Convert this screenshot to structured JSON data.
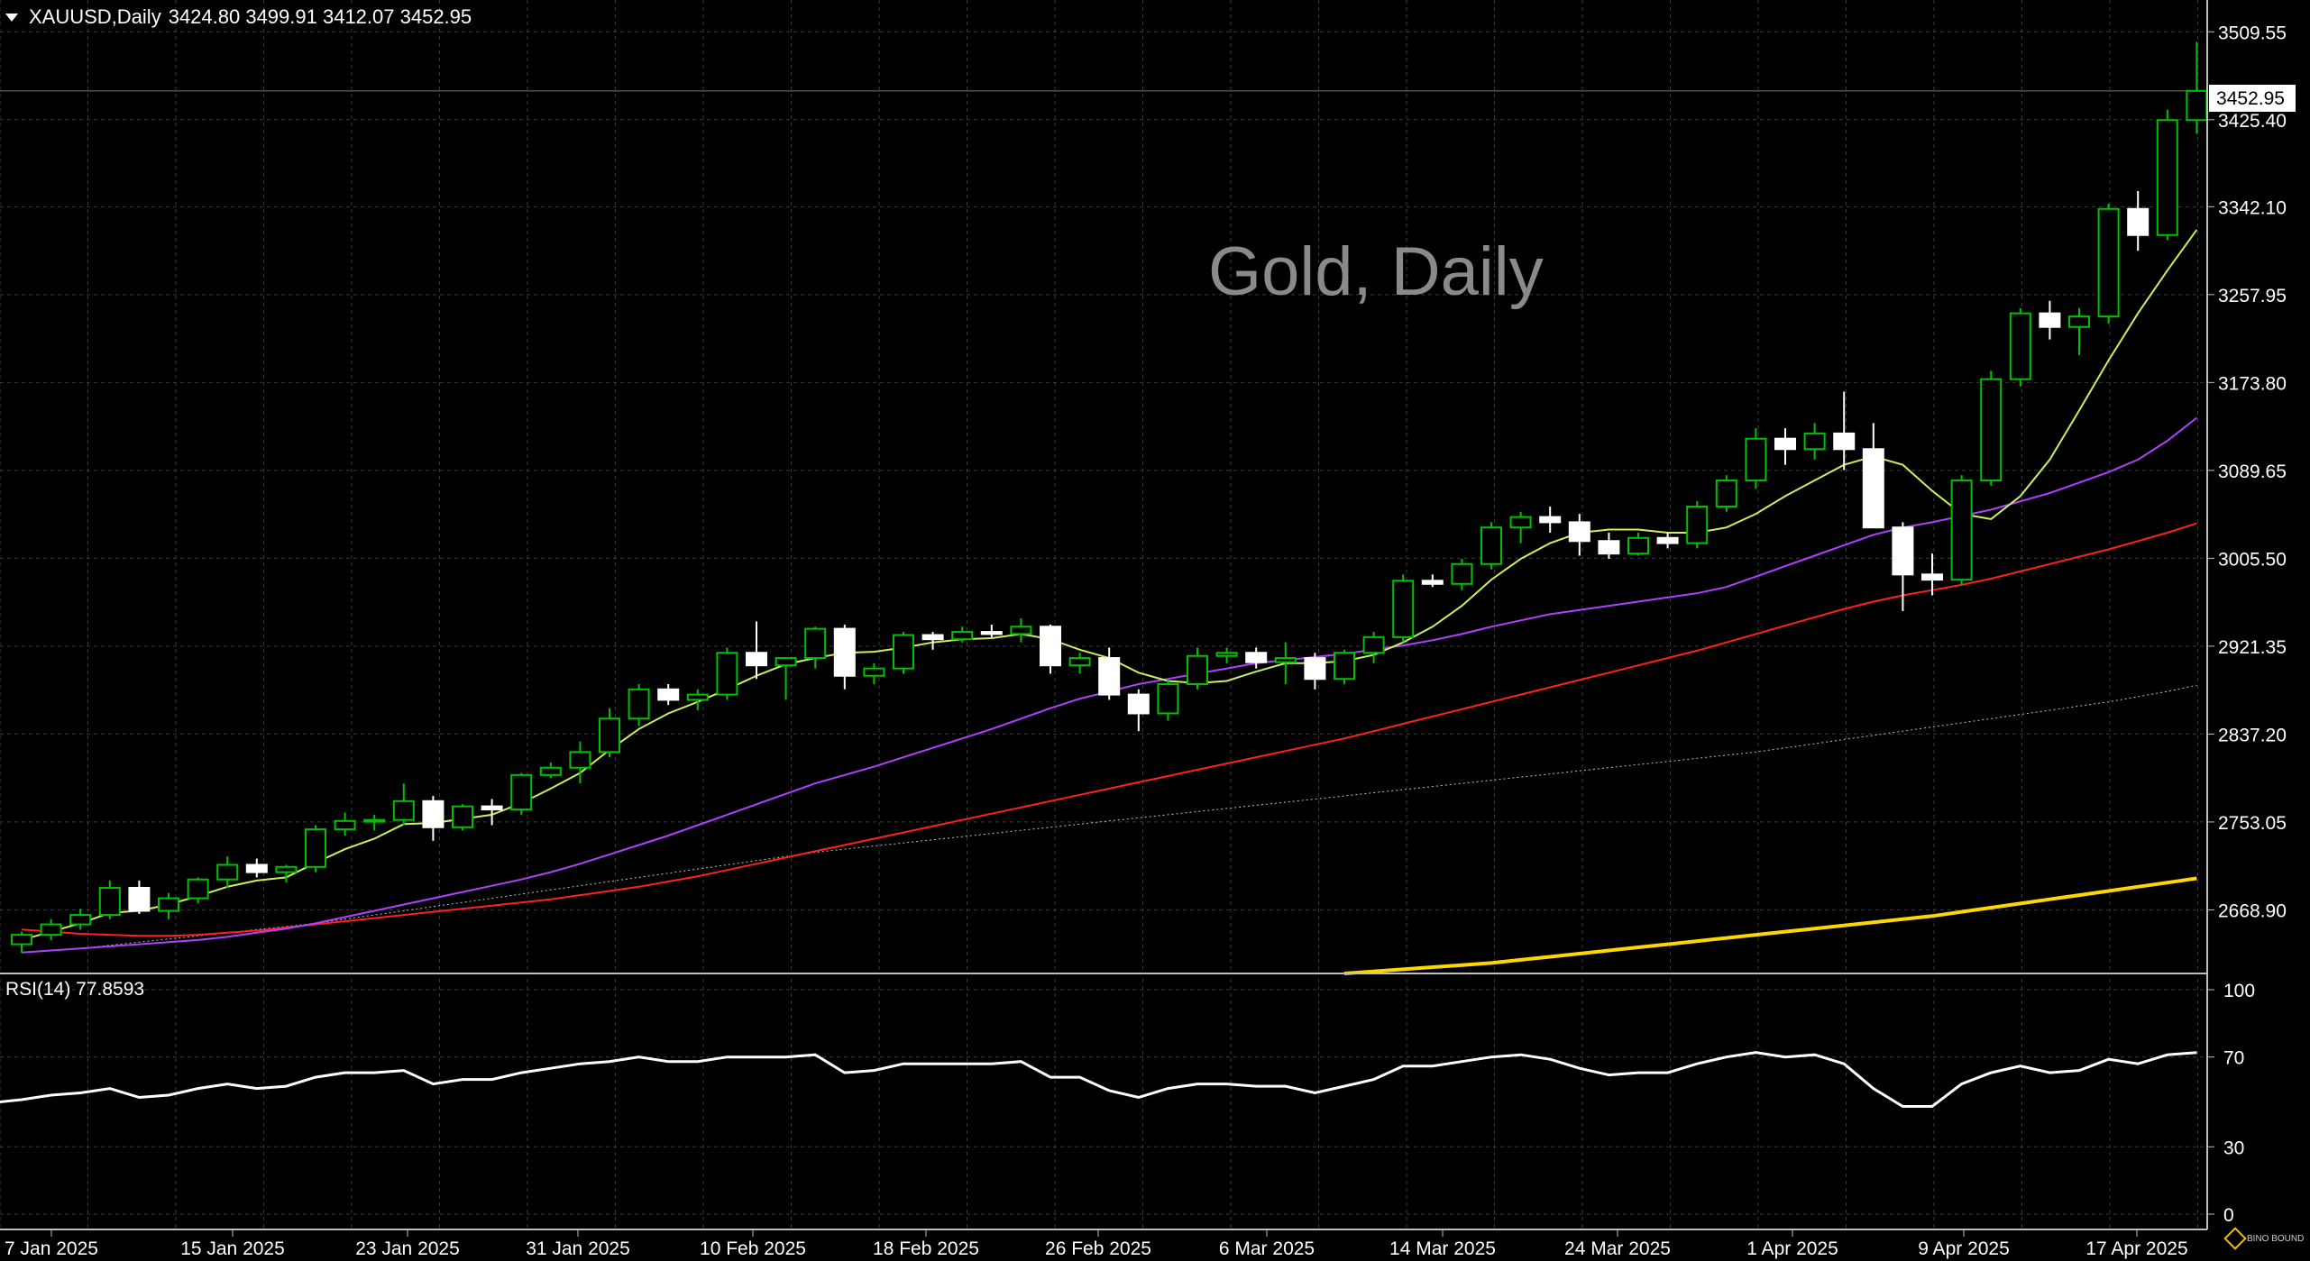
{
  "header": {
    "symbol": "XAUUSD,Daily",
    "ohlc": "3424.80 3499.91 3412.07 3452.95"
  },
  "watermark": "Gold, Daily",
  "colors": {
    "background": "#000000",
    "grid": "#3a3a3a",
    "bull_candle": "#00c000",
    "bear_candle": "#ffffff",
    "ma_fast": "#c8f060",
    "ma_mid": "#b040ff",
    "ma_slow": "#ff2020",
    "ma_dotted": "#c0c0c0",
    "ma_long": "#ffd700",
    "rsi": "#ffffff"
  },
  "price_axis": {
    "ticks": [
      "3509.55",
      "3425.40",
      "3342.10",
      "3257.95",
      "3173.80",
      "3089.65",
      "3005.50",
      "2921.35",
      "2837.20",
      "2753.05",
      "2668.90"
    ],
    "current_price": "3452.95"
  },
  "rsi_panel": {
    "label": "RSI(14) 77.8593",
    "ticks": [
      "100",
      "70",
      "30",
      "0"
    ]
  },
  "date_axis": {
    "labels": [
      "7 Jan 2025",
      "15 Jan 2025",
      "23 Jan 2025",
      "31 Jan 2025",
      "10 Feb 2025",
      "18 Feb 2025",
      "26 Feb 2025",
      "6 Mar 2025",
      "14 Mar 2025",
      "24 Mar 2025",
      "1 Apr 2025",
      "9 Apr 2025",
      "17 Apr 2025"
    ]
  },
  "logo_text": "BINO BOUND",
  "chart_data": {
    "type": "candlestick",
    "title": "Gold, Daily",
    "ylim": [
      2608,
      3540
    ],
    "candles": [
      [
        2636,
        2648,
        2628,
        2645
      ],
      [
        2645,
        2660,
        2640,
        2655
      ],
      [
        2655,
        2670,
        2650,
        2664
      ],
      [
        2664,
        2697,
        2660,
        2690
      ],
      [
        2690,
        2697,
        2665,
        2668
      ],
      [
        2668,
        2685,
        2660,
        2680
      ],
      [
        2680,
        2700,
        2675,
        2698
      ],
      [
        2698,
        2720,
        2690,
        2712
      ],
      [
        2712,
        2718,
        2700,
        2705
      ],
      [
        2705,
        2712,
        2695,
        2710
      ],
      [
        2710,
        2750,
        2705,
        2746
      ],
      [
        2746,
        2762,
        2740,
        2754
      ],
      [
        2754,
        2760,
        2745,
        2755
      ],
      [
        2755,
        2790,
        2750,
        2773
      ],
      [
        2773,
        2778,
        2735,
        2748
      ],
      [
        2748,
        2770,
        2745,
        2768
      ],
      [
        2768,
        2775,
        2750,
        2765
      ],
      [
        2765,
        2800,
        2760,
        2798
      ],
      [
        2798,
        2810,
        2795,
        2805
      ],
      [
        2805,
        2830,
        2790,
        2820
      ],
      [
        2820,
        2862,
        2815,
        2852
      ],
      [
        2852,
        2885,
        2845,
        2880
      ],
      [
        2880,
        2885,
        2865,
        2870
      ],
      [
        2870,
        2880,
        2860,
        2875
      ],
      [
        2875,
        2920,
        2870,
        2915
      ],
      [
        2915,
        2945,
        2890,
        2903
      ],
      [
        2903,
        2910,
        2870,
        2910
      ],
      [
        2910,
        2940,
        2900,
        2938
      ],
      [
        2938,
        2942,
        2880,
        2893
      ],
      [
        2893,
        2905,
        2885,
        2900
      ],
      [
        2900,
        2935,
        2895,
        2932
      ],
      [
        2932,
        2935,
        2918,
        2928
      ],
      [
        2928,
        2940,
        2925,
        2935
      ],
      [
        2935,
        2942,
        2930,
        2933
      ],
      [
        2933,
        2948,
        2925,
        2940
      ],
      [
        2940,
        2942,
        2895,
        2903
      ],
      [
        2903,
        2915,
        2895,
        2910
      ],
      [
        2910,
        2920,
        2870,
        2875
      ],
      [
        2875,
        2880,
        2840,
        2857
      ],
      [
        2857,
        2890,
        2850,
        2885
      ],
      [
        2885,
        2920,
        2880,
        2912
      ],
      [
        2912,
        2920,
        2905,
        2915
      ],
      [
        2915,
        2920,
        2900,
        2906
      ],
      [
        2906,
        2925,
        2885,
        2910
      ],
      [
        2910,
        2915,
        2880,
        2890
      ],
      [
        2890,
        2918,
        2885,
        2915
      ],
      [
        2915,
        2935,
        2905,
        2930
      ],
      [
        2930,
        2990,
        2925,
        2984
      ],
      [
        2984,
        2990,
        2978,
        2981
      ],
      [
        2981,
        3005,
        2975,
        3000
      ],
      [
        3000,
        3040,
        2995,
        3035
      ],
      [
        3035,
        3050,
        3020,
        3045
      ],
      [
        3045,
        3055,
        3030,
        3040
      ],
      [
        3040,
        3048,
        3008,
        3022
      ],
      [
        3022,
        3030,
        3005,
        3010
      ],
      [
        3010,
        3030,
        3008,
        3025
      ],
      [
        3025,
        3030,
        3015,
        3020
      ],
      [
        3020,
        3060,
        3015,
        3055
      ],
      [
        3055,
        3085,
        3050,
        3080
      ],
      [
        3080,
        3130,
        3072,
        3120
      ],
      [
        3120,
        3130,
        3095,
        3110
      ],
      [
        3110,
        3135,
        3100,
        3125
      ],
      [
        3125,
        3165,
        3090,
        3110
      ],
      [
        3110,
        3135,
        3050,
        3035
      ],
      [
        3035,
        3040,
        2955,
        2990
      ],
      [
        2990,
        3010,
        2970,
        2985
      ],
      [
        2985,
        3085,
        2980,
        3080
      ],
      [
        3080,
        3185,
        3075,
        3177
      ],
      [
        3177,
        3245,
        3170,
        3240
      ],
      [
        3240,
        3252,
        3215,
        3227
      ],
      [
        3227,
        3245,
        3200,
        3237
      ],
      [
        3237,
        3345,
        3230,
        3340
      ],
      [
        3340,
        3357,
        3300,
        3315
      ],
      [
        3315,
        3435,
        3310,
        3425
      ],
      [
        3425,
        3500,
        3412,
        3453
      ]
    ],
    "ma_fast": [
      2640,
      2648,
      2656,
      2666,
      2668,
      2674,
      2682,
      2691,
      2697,
      2700,
      2714,
      2727,
      2737,
      2751,
      2752,
      2756,
      2760,
      2771,
      2785,
      2800,
      2822,
      2842,
      2857,
      2868,
      2880,
      2893,
      2904,
      2910,
      2915,
      2916,
      2920,
      2925,
      2928,
      2929,
      2933,
      2928,
      2918,
      2910,
      2896,
      2888,
      2886,
      2888,
      2897,
      2905,
      2905,
      2907,
      2913,
      2925,
      2940,
      2960,
      2985,
      3005,
      3020,
      3030,
      3033,
      3033,
      3030,
      3030,
      3035,
      3048,
      3065,
      3080,
      3095,
      3103,
      3095,
      3070,
      3048,
      3043,
      3065,
      3100,
      3147,
      3195,
      3240,
      3281,
      3320
    ],
    "ma_mid": [
      2628,
      2630,
      2632,
      2634,
      2636,
      2638,
      2640,
      2643,
      2647,
      2651,
      2656,
      2662,
      2668,
      2674,
      2680,
      2686,
      2692,
      2698,
      2705,
      2713,
      2722,
      2731,
      2740,
      2750,
      2760,
      2770,
      2780,
      2790,
      2798,
      2806,
      2815,
      2824,
      2833,
      2842,
      2852,
      2862,
      2871,
      2878,
      2885,
      2890,
      2895,
      2900,
      2905,
      2908,
      2911,
      2914,
      2918,
      2922,
      2927,
      2933,
      2940,
      2946,
      2952,
      2956,
      2960,
      2964,
      2968,
      2972,
      2978,
      2988,
      2998,
      3008,
      3018,
      3028,
      3035,
      3040,
      3046,
      3052,
      3060,
      3068,
      3078,
      3088,
      3100,
      3118,
      3140
    ],
    "ma_slow": [
      2650,
      2648,
      2646,
      2645,
      2644,
      2644,
      2645,
      2647,
      2649,
      2652,
      2655,
      2658,
      2661,
      2664,
      2667,
      2670,
      2673,
      2676,
      2679,
      2683,
      2687,
      2691,
      2696,
      2701,
      2707,
      2713,
      2719,
      2725,
      2731,
      2737,
      2743,
      2749,
      2755,
      2761,
      2767,
      2773,
      2779,
      2785,
      2791,
      2797,
      2803,
      2809,
      2815,
      2821,
      2827,
      2833,
      2840,
      2847,
      2854,
      2861,
      2868,
      2875,
      2882,
      2889,
      2896,
      2903,
      2910,
      2917,
      2925,
      2933,
      2941,
      2949,
      2957,
      2964,
      2970,
      2975,
      2980,
      2986,
      2993,
      3000,
      3007,
      3014,
      3022,
      3030,
      3039
    ],
    "ma_dotted": [
      2628,
      2630,
      2632,
      2635,
      2638,
      2641,
      2644,
      2647,
      2650,
      2653,
      2656,
      2660,
      2664,
      2668,
      2672,
      2676,
      2680,
      2684,
      2688,
      2692,
      2696,
      2700,
      2704,
      2708,
      2712,
      2716,
      2720,
      2724,
      2727,
      2730,
      2733,
      2736,
      2739,
      2742,
      2745,
      2748,
      2751,
      2754,
      2757,
      2760,
      2763,
      2766,
      2769,
      2772,
      2775,
      2778,
      2781,
      2784,
      2787,
      2790,
      2793,
      2796,
      2799,
      2802,
      2805,
      2808,
      2811,
      2814,
      2817,
      2820,
      2824,
      2828,
      2832,
      2836,
      2840,
      2844,
      2848,
      2852,
      2856,
      2860,
      2864,
      2868,
      2873,
      2878,
      2884
    ],
    "ma_long": {
      "start_index": 45,
      "values": [
        2608,
        2610,
        2612,
        2614,
        2616,
        2618,
        2621,
        2624,
        2627,
        2630,
        2633,
        2636,
        2639,
        2642,
        2645,
        2648,
        2651,
        2654,
        2657,
        2660,
        2663,
        2667,
        2671,
        2675,
        2679,
        2683,
        2687,
        2691,
        2695,
        2699
      ]
    },
    "rsi": [
      51,
      53,
      54,
      56,
      52,
      53,
      56,
      58,
      56,
      57,
      61,
      63,
      63,
      64,
      58,
      60,
      60,
      63,
      65,
      67,
      68,
      70,
      68,
      68,
      70,
      70,
      70,
      71,
      63,
      64,
      67,
      67,
      67,
      67,
      68,
      61,
      61,
      55,
      52,
      56,
      58,
      58,
      57,
      57,
      54,
      57,
      60,
      66,
      66,
      68,
      70,
      71,
      69,
      65,
      62,
      63,
      63,
      67,
      70,
      72,
      70,
      71,
      67,
      56,
      48,
      48,
      58,
      63,
      66,
      63,
      64,
      69,
      67,
      71,
      72
    ],
    "rsi_ylim": [
      0,
      100
    ]
  }
}
